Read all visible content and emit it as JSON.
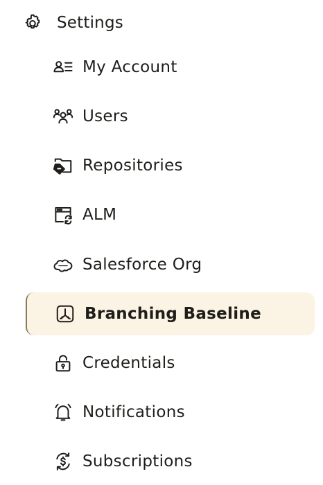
{
  "header": {
    "label": "Settings",
    "icon": "gear-icon"
  },
  "nav": {
    "items": [
      {
        "label": "My Account",
        "icon": "account-list-icon",
        "active": false
      },
      {
        "label": "Users",
        "icon": "users-group-icon",
        "active": false
      },
      {
        "label": "Repositories",
        "icon": "repository-folder-icon",
        "active": false
      },
      {
        "label": "ALM",
        "icon": "alm-window-sync-icon",
        "active": false
      },
      {
        "label": "Salesforce Org",
        "icon": "salesforce-cloud-icon",
        "active": false
      },
      {
        "label": "Branching Baseline",
        "icon": "branching-baseline-icon",
        "active": true
      },
      {
        "label": "Credentials",
        "icon": "padlock-icon",
        "active": false
      },
      {
        "label": "Notifications",
        "icon": "bell-icon",
        "active": false
      },
      {
        "label": "Subscriptions",
        "icon": "dollar-refresh-icon",
        "active": false
      }
    ]
  },
  "colors": {
    "active_background": "#fbf3e4",
    "active_border": "#8a7a54",
    "text": "#1f1d1a"
  }
}
